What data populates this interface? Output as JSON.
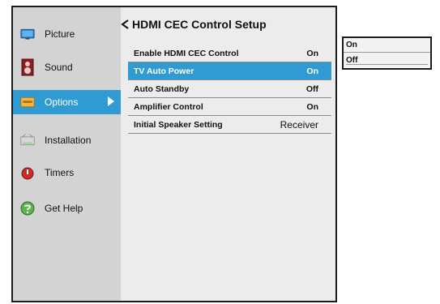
{
  "sidebar": {
    "items": [
      {
        "label": "Picture",
        "icon": "picture-icon"
      },
      {
        "label": "Sound",
        "icon": "speaker-icon"
      },
      {
        "label": "Options",
        "icon": "options-icon",
        "active": true
      },
      {
        "label": "Installation",
        "icon": "installation-icon"
      },
      {
        "label": "Timers",
        "icon": "timer-icon"
      },
      {
        "label": "Get Help",
        "icon": "help-icon"
      }
    ]
  },
  "panel": {
    "title": "HDMI CEC Control Setup",
    "rows": [
      {
        "label": "Enable HDMI CEC Control",
        "value": "On"
      },
      {
        "label": "TV Auto Power",
        "value": "On",
        "selected": true
      },
      {
        "label": "Auto Standby",
        "value": "Off"
      },
      {
        "label": "Amplifier Control",
        "value": "On"
      },
      {
        "label": "Initial Speaker Setting",
        "value": "Receiver"
      }
    ]
  },
  "popup": {
    "options": [
      "On",
      "Off"
    ]
  },
  "colors": {
    "accent": "#2f9bd2",
    "sidebar_bg": "#d3d3d3",
    "panel_bg": "#ececec"
  }
}
